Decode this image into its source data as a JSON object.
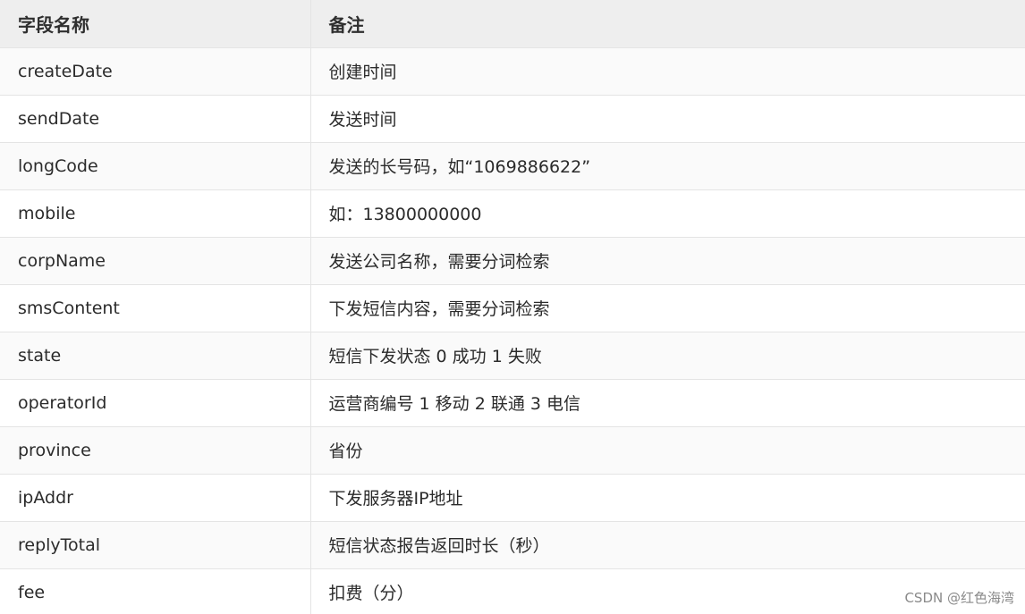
{
  "table": {
    "headers": [
      "字段名称",
      "备注"
    ],
    "rows": [
      {
        "field": "createDate",
        "note": "创建时间"
      },
      {
        "field": "sendDate",
        "note": "发送时间"
      },
      {
        "field": "longCode",
        "note": "发送的长号码，如“1069886622”"
      },
      {
        "field": "mobile",
        "note": "如：13800000000"
      },
      {
        "field": "corpName",
        "note": "发送公司名称，需要分词检索"
      },
      {
        "field": "smsContent",
        "note": "下发短信内容，需要分词检索"
      },
      {
        "field": "state",
        "note": "短信下发状态 0 成功 1 失败"
      },
      {
        "field": "operatorId",
        "note": "运营商编号 1 移动 2 联通 3 电信"
      },
      {
        "field": "province",
        "note": "省份"
      },
      {
        "field": "ipAddr",
        "note": "下发服务器IP地址"
      },
      {
        "field": "replyTotal",
        "note": "短信状态报告返回时长（秒）"
      },
      {
        "field": "fee",
        "note": "扣费（分）"
      }
    ]
  },
  "watermark": "CSDN @红色海湾"
}
